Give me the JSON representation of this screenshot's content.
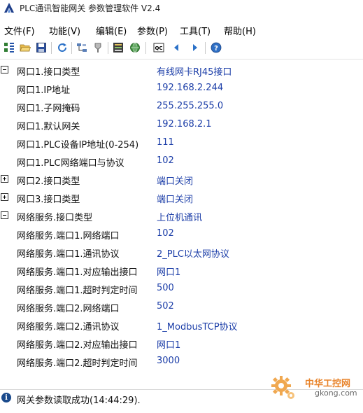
{
  "window": {
    "title": "PLC通讯智能网关 参数管理软件 V2.4"
  },
  "menu": {
    "file": "文件(F)",
    "function": "功能(V)",
    "edit": "编辑(E)",
    "params": "参数(P)",
    "tools": "工具(T)",
    "help": "帮助(H)"
  },
  "toolbar_icons": [
    "grid-tree-icon",
    "open-folder-icon",
    "save-icon",
    "refresh-icon",
    "network-icon",
    "plug-icon",
    "device-config-icon",
    "globe-icon",
    "qc-icon",
    "previous-arrow-icon",
    "next-arrow-icon",
    "help-icon"
  ],
  "params": [
    {
      "name": "网口1.接口类型",
      "value": "有线网卡RJ45接口",
      "expander": "collapse"
    },
    {
      "name": "网口1.IP地址",
      "value": "192.168.2.244",
      "expander": ""
    },
    {
      "name": "网口1.子网掩码",
      "value": "255.255.255.0",
      "expander": ""
    },
    {
      "name": "网口1.默认网关",
      "value": "192.168.2.1",
      "expander": ""
    },
    {
      "name": "网口1.PLC设备IP地址(0-254)",
      "value": "111",
      "expander": ""
    },
    {
      "name": "网口1.PLC网络端口与协议",
      "value": "102",
      "expander": ""
    },
    {
      "name": "网口2.接口类型",
      "value": "端口关闭",
      "expander": "expand"
    },
    {
      "name": "网口3.接口类型",
      "value": "端口关闭",
      "expander": "expand"
    },
    {
      "name": "网络服务.接口类型",
      "value": "上位机通讯",
      "expander": "collapse"
    },
    {
      "name": "网络服务.端口1.网络端口",
      "value": "102",
      "expander": ""
    },
    {
      "name": "网络服务.端口1.通讯协议",
      "value": "2_PLC以太网协议",
      "expander": ""
    },
    {
      "name": "网络服务.端口1.对应输出接口",
      "value": "网口1",
      "expander": ""
    },
    {
      "name": "网络服务.端口1.超时判定时间",
      "value": "500",
      "expander": ""
    },
    {
      "name": "网络服务.端口2.网络端口",
      "value": "502",
      "expander": ""
    },
    {
      "name": "网络服务.端口2.通讯协议",
      "value": "1_ModbusTCP协议",
      "expander": ""
    },
    {
      "name": "网络服务.端口2.对应输出接口",
      "value": "网口1",
      "expander": ""
    },
    {
      "name": "网络服务.端口2.超时判定时间",
      "value": "3000",
      "expander": ""
    }
  ],
  "status": {
    "icon_glyph": "i",
    "text": "网关参数读取成功(14:44:29)."
  },
  "watermark": {
    "name": "中华工控网",
    "url": "gkong.com"
  },
  "colors": {
    "value_text": "#1c3ea8",
    "status_icon": "#1a4a8c",
    "watermark_orange": "#e8832a"
  }
}
